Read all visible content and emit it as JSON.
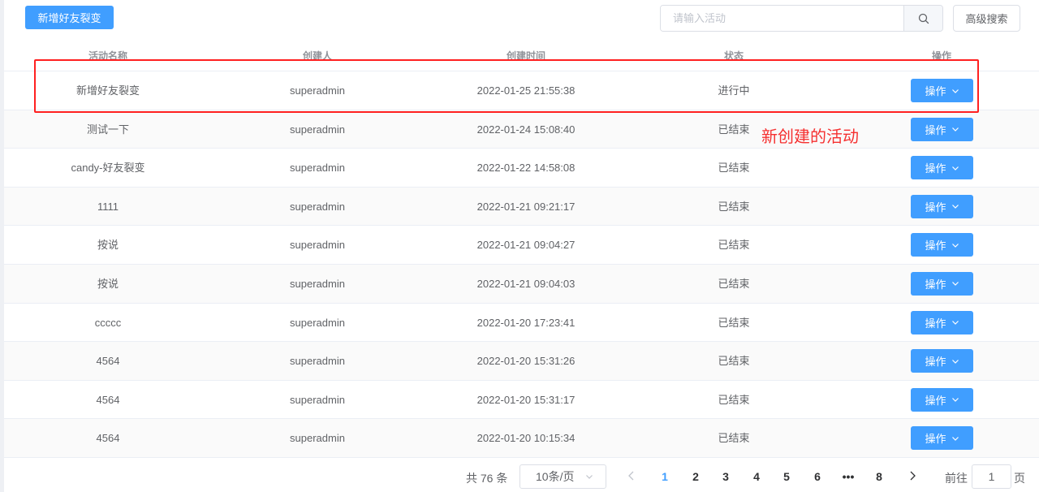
{
  "toolbar": {
    "add_button_label": "新增好友裂变",
    "search_placeholder": "请输入活动",
    "advanced_search_label": "高级搜索"
  },
  "table": {
    "columns": [
      "活动名称",
      "创建人",
      "创建时间",
      "状态",
      "操作"
    ],
    "rows": [
      {
        "name": "新增好友裂变",
        "creator": "superadmin",
        "created": "2022-01-25 21:55:38",
        "status": "进行中",
        "action": "操作"
      },
      {
        "name": "测试一下",
        "creator": "superadmin",
        "created": "2022-01-24 15:08:40",
        "status": "已结束",
        "action": "操作"
      },
      {
        "name": "candy-好友裂变",
        "creator": "superadmin",
        "created": "2022-01-22 14:58:08",
        "status": "已结束",
        "action": "操作"
      },
      {
        "name": "1111",
        "creator": "superadmin",
        "created": "2022-01-21 09:21:17",
        "status": "已结束",
        "action": "操作"
      },
      {
        "name": "按说",
        "creator": "superadmin",
        "created": "2022-01-21 09:04:27",
        "status": "已结束",
        "action": "操作"
      },
      {
        "name": "按说",
        "creator": "superadmin",
        "created": "2022-01-21 09:04:03",
        "status": "已结束",
        "action": "操作"
      },
      {
        "name": "ccccc",
        "creator": "superadmin",
        "created": "2022-01-20 17:23:41",
        "status": "已结束",
        "action": "操作"
      },
      {
        "name": "4564",
        "creator": "superadmin",
        "created": "2022-01-20 15:31:26",
        "status": "已结束",
        "action": "操作"
      },
      {
        "name": "4564",
        "creator": "superadmin",
        "created": "2022-01-20 15:31:17",
        "status": "已结束",
        "action": "操作"
      },
      {
        "name": "4564",
        "creator": "superadmin",
        "created": "2022-01-20 10:15:34",
        "status": "已结束",
        "action": "操作"
      }
    ]
  },
  "annotation": {
    "text": "新创建的活动",
    "color": "#f53030"
  },
  "pagination": {
    "total_text": "共 76 条",
    "page_size": "10条/页",
    "pages": [
      "1",
      "2",
      "3",
      "4",
      "5",
      "6",
      "•••",
      "8"
    ],
    "current_page": "1",
    "goto_label": "前往",
    "goto_value": "1",
    "goto_unit": "页"
  },
  "colors": {
    "primary": "#409eff",
    "annotation_red": "#ff2020"
  }
}
